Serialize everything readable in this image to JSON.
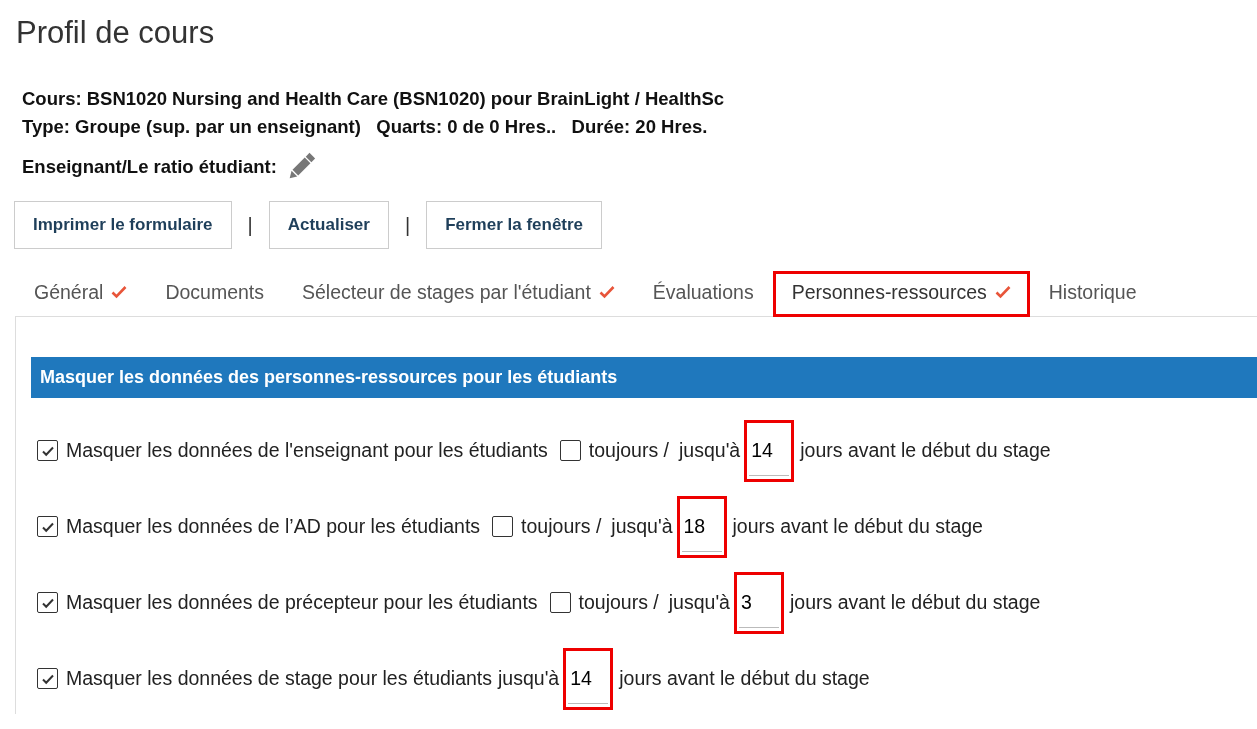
{
  "title": "Profil de cours",
  "info": [
    {
      "text": "Cours: BSN1020 Nursing and Health Care (BSN1020) pour BrainLight / HealthSc"
    },
    {
      "text": "Type: Groupe (sup. par un enseignant)   Quarts: 0 de 0 Hres..   Durée: 20 Hres."
    },
    {
      "text": "Enseignant/Le ratio étudiant:",
      "editable": true
    }
  ],
  "buttons": [
    "Imprimer le formulaire",
    "Actualiser",
    "Fermer la fenêtre"
  ],
  "button_separators": [
    "|",
    "|"
  ],
  "tabs": [
    {
      "label": "Général",
      "done": true,
      "selected": false,
      "highlighted": false
    },
    {
      "label": "Documents",
      "done": false,
      "selected": false,
      "highlighted": false
    },
    {
      "label": "Sélecteur de stages par l'étudiant",
      "done": true,
      "selected": false,
      "highlighted": false
    },
    {
      "label": "Évaluations",
      "done": false,
      "selected": false,
      "highlighted": false
    },
    {
      "label": "Personnes-ressources",
      "done": true,
      "selected": true,
      "highlighted": true
    },
    {
      "label": "Historique",
      "done": false,
      "selected": false,
      "highlighted": false
    }
  ],
  "section": {
    "header": "Masquer les données des personnes-ressources pour les étudiants",
    "rows": [
      {
        "label": "Masquer les données de l'enseignant pour les étudiants",
        "checked": true,
        "always": {
          "label": "toujours /",
          "checked": false
        },
        "until": "jusqu'à",
        "days": "14",
        "highlighted": true,
        "suffix": "jours avant le début du stage"
      },
      {
        "label": "Masquer les données de l’AD pour les étudiants",
        "checked": true,
        "always": {
          "label": "toujours /",
          "checked": false
        },
        "until": "jusqu'à",
        "days": "18",
        "highlighted": true,
        "suffix": "jours avant le début du stage"
      },
      {
        "label": "Masquer les données de précepteur pour les étudiants",
        "checked": true,
        "always": {
          "label": "toujours /",
          "checked": false
        },
        "until": "jusqu'à",
        "days": "3",
        "highlighted": true,
        "suffix": "jours avant le début du stage"
      },
      {
        "label": "Masquer les données de stage pour les étudiants",
        "checked": true,
        "until": "jusqu'à",
        "days": "14",
        "highlighted": true,
        "suffix": "jours avant le début du stage"
      }
    ]
  }
}
